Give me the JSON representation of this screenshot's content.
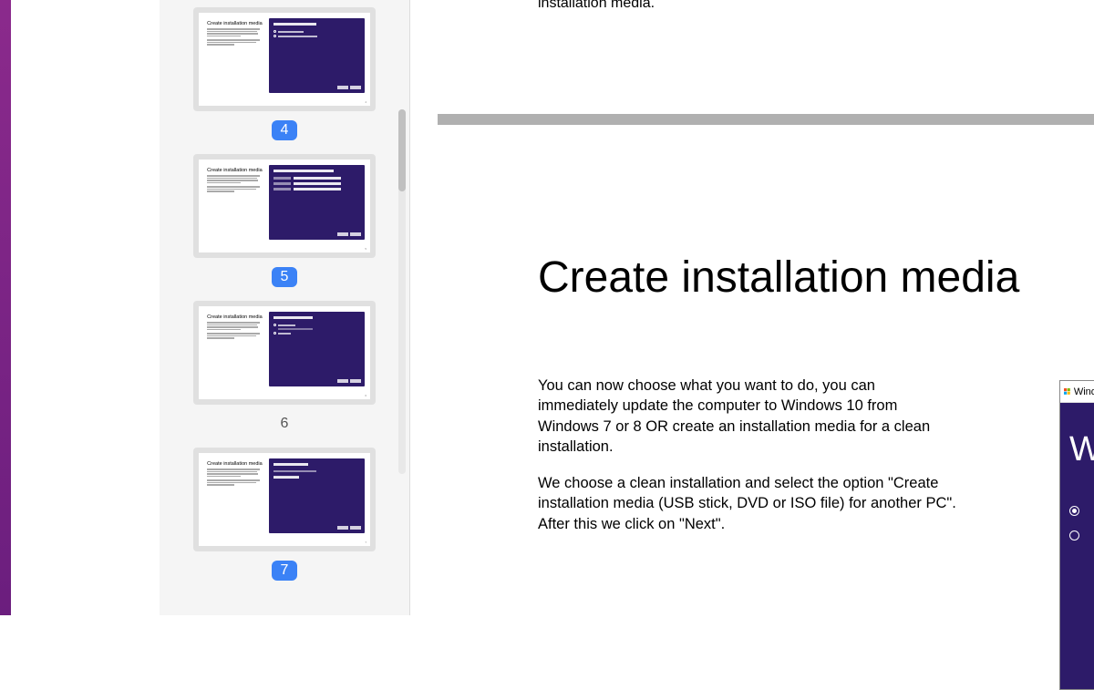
{
  "thumbnails": [
    {
      "number": "4",
      "selected": true,
      "title": "Create installation media",
      "variant": "radio"
    },
    {
      "number": "5",
      "selected": true,
      "title": "Create installation media",
      "variant": "inputs"
    },
    {
      "number": "6",
      "selected": false,
      "title": "Create installation media",
      "variant": "radio2"
    },
    {
      "number": "7",
      "selected": true,
      "title": "Create installation media",
      "variant": "select"
    }
  ],
  "prev_slide_snippet": "installation media.",
  "main_slide": {
    "title": "Create installation media",
    "paragraph1": "You can now choose what you want to do, you can immediately update the computer to Windows 10 from Windows 7 or 8 OR create an installation media for a clean installation.",
    "paragraph2": "We choose a clean installation and select the option \"Create installation media (USB stick, DVD or ISO file) for another PC\". After this we click on \"Next\"."
  },
  "peek": {
    "title_fragment": "Windo",
    "big_letter": "W"
  }
}
